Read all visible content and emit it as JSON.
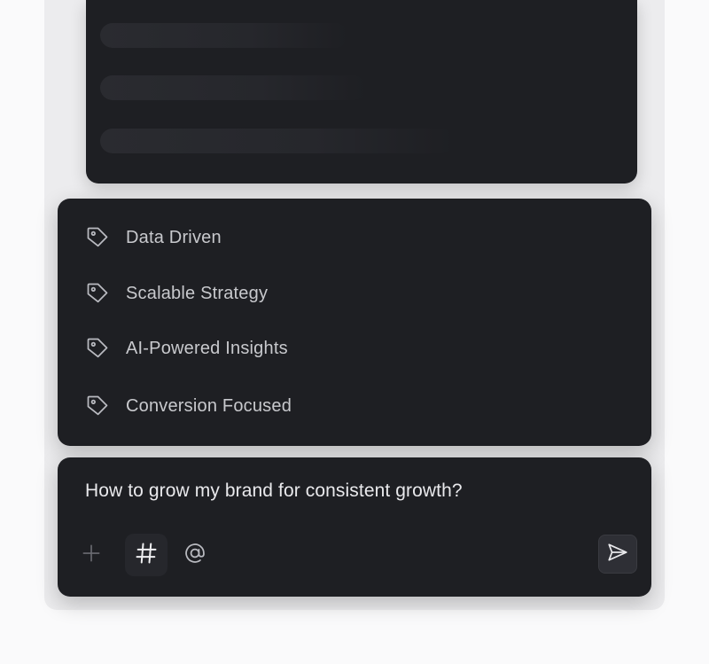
{
  "tags": {
    "items": [
      {
        "label": "Data Driven",
        "icon": "tag-icon"
      },
      {
        "label": "Scalable Strategy",
        "icon": "tag-icon"
      },
      {
        "label": "AI-Powered Insights",
        "icon": "tag-icon"
      },
      {
        "label": "Conversion Focused",
        "icon": "tag-icon"
      }
    ]
  },
  "composer": {
    "prompt_text": "How to grow my brand for consistent growth?",
    "tools": [
      {
        "icon": "plus-icon"
      },
      {
        "icon": "hashtag-icon",
        "active": true
      },
      {
        "icon": "at-sign-icon"
      }
    ],
    "send_icon": "send-icon"
  },
  "colors": {
    "panel_bg": "#1e1f23",
    "page_bg": "#fafafb",
    "text_primary": "#e9e9ec",
    "text_secondary": "#c8c9cd"
  }
}
